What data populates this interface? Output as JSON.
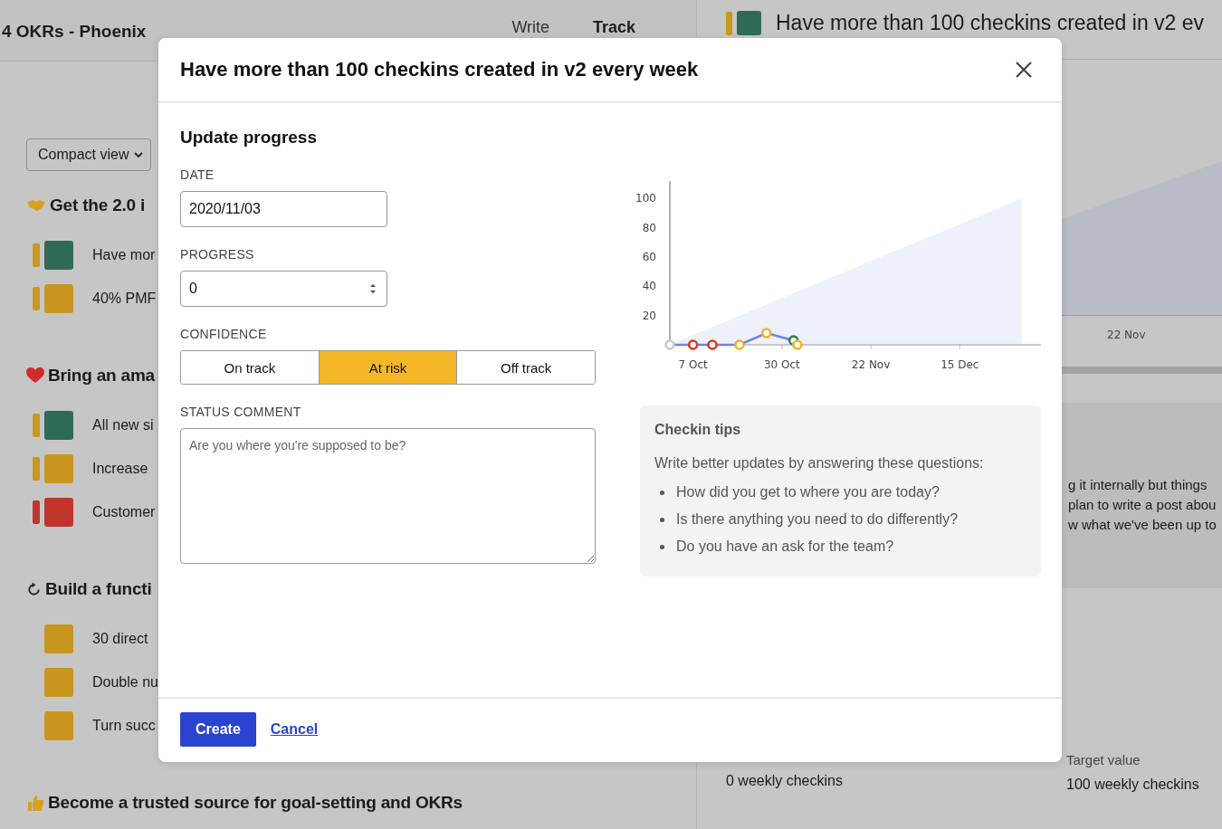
{
  "background": {
    "board_title": "4 OKRs - Phoenix",
    "tabs": [
      {
        "label": "Write",
        "selected": false
      },
      {
        "label": "Track",
        "selected": true
      }
    ],
    "view_select": "Compact view",
    "objectives": [
      {
        "title": "Get the 2.0 i",
        "key_results": [
          {
            "text": "Have mor",
            "trend": {
              "color": "#c9961f"
            },
            "color": "#2e6b56"
          },
          {
            "text": "40% PMF",
            "trend": {
              "color": "#c9961f"
            },
            "color": "#c8961f"
          }
        ]
      },
      {
        "title": "Bring an ama",
        "key_results": [
          {
            "text": "All new si",
            "trend": {
              "color": "#c9961f"
            },
            "color": "#2e6b56"
          },
          {
            "text": "Increase",
            "trend": {
              "color": "#c9961f"
            },
            "color": "#c8961f"
          },
          {
            "text": "Customer",
            "trend": {
              "color": "#c0352b"
            },
            "color": "#c0352b"
          }
        ]
      },
      {
        "title": "Build a functi",
        "key_results": [
          {
            "text": "30 direct",
            "color": "#c8961f"
          },
          {
            "text": "Double nu",
            "color": "#c8961f"
          },
          {
            "text": "Turn succ",
            "color": "#c8961f"
          }
        ]
      },
      {
        "title": "Become a trusted source for goal-setting and OKRs"
      }
    ],
    "detail": {
      "title": "Have more than 100 checkins created in v2 ev",
      "trend": {
        "color": "#c9961f"
      },
      "color": "#2e6b56",
      "axis_label": "22 Nov",
      "comment_lines": [
        "g it internally but things",
        "plan to write a post abou",
        "w what we've been up to"
      ],
      "initial_value": "0 weekly checkins",
      "target_label": "Target value",
      "target_value": "100 weekly checkins"
    }
  },
  "modal": {
    "title": "Have more than 100 checkins created in v2 every week",
    "heading": "Update progress",
    "date": {
      "label": "DATE",
      "value": "2020/11/03"
    },
    "progress": {
      "label": "PROGRESS",
      "value": "0"
    },
    "confidence": {
      "label": "CONFIDENCE",
      "options": [
        {
          "label": "On track",
          "selected": false
        },
        {
          "label": "At risk",
          "selected": true
        },
        {
          "label": "Off track",
          "selected": false
        }
      ]
    },
    "comment": {
      "label": "STATUS COMMENT",
      "placeholder": "Are you where you're supposed to be?"
    },
    "chart": {
      "chart_data": {
        "type": "line",
        "x": [
          "2020-10-01",
          "2020-10-07",
          "2020-10-12",
          "2020-10-19",
          "2020-10-26",
          "2020-11-02",
          "2020-11-03",
          "2020-12-31"
        ],
        "series": [
          {
            "color": "#6c86e0",
            "marker": "circle",
            "values": [
              0,
              0,
              0,
              0,
              8,
              3,
              0,
              null
            ]
          },
          {
            "type": "area",
            "color": "#eef0fb",
            "values": [
              0,
              6.6,
              12.1,
              19.8,
              27.5,
              35.2,
              36.3,
              100
            ]
          }
        ],
        "xticks": [
          {
            "value": "2020-10-07",
            "label": "7 Oct"
          },
          {
            "value": "2020-10-30",
            "label": "30 Oct"
          },
          {
            "value": "2020-11-22",
            "label": "22 Nov"
          },
          {
            "value": "2020-12-15",
            "label": "15 Dec"
          }
        ],
        "yticks": [
          20,
          40,
          60,
          80,
          100
        ],
        "xlim": [
          "2020-10-01",
          "2021-01-05"
        ],
        "ylim": [
          0,
          112
        ]
      },
      "checkin_markers": [
        {
          "color": "#c8c8c8"
        },
        {
          "color": "#d93a26"
        },
        {
          "color": "#d93a26"
        },
        {
          "color": "#f2b321"
        },
        {
          "color": "#f2b321"
        },
        {
          "color": "#2e7d5b"
        },
        {
          "color": "#f2b321"
        }
      ]
    },
    "tips": {
      "title": "Checkin tips",
      "intro": "Write better updates by answering these questions:",
      "items": [
        "How did you get to where you are today?",
        "Is there anything you need to do differently?",
        "Do you have an ask for the team?"
      ]
    },
    "buttons": {
      "primary": "Create",
      "secondary": "Cancel"
    }
  }
}
